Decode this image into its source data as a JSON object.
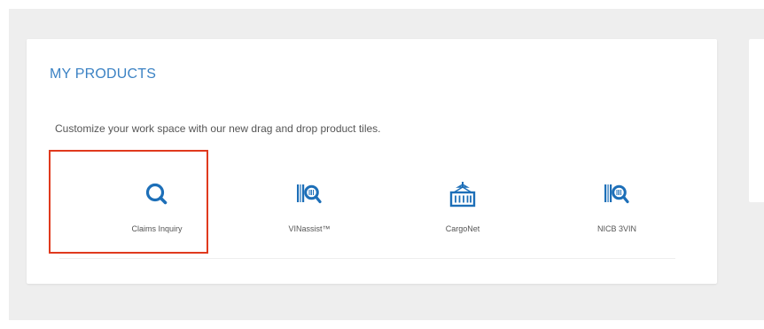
{
  "colors": {
    "accent": "#3b82c4",
    "icon": "#1d6fb8",
    "highlight": "#e03a1e",
    "background": "#eeeeee"
  },
  "my_products": {
    "title": "MY PRODUCTS",
    "description": "Customize your work space with our new drag and drop product tiles.",
    "tiles": [
      {
        "label": "Claims Inquiry",
        "icon": "search-icon"
      },
      {
        "label": "VINassist™",
        "icon": "vin-barcode-search-icon"
      },
      {
        "label": "CargoNet",
        "icon": "cargo-container-icon"
      },
      {
        "label": "NICB 3VIN",
        "icon": "vin-barcode-search-icon"
      }
    ]
  }
}
